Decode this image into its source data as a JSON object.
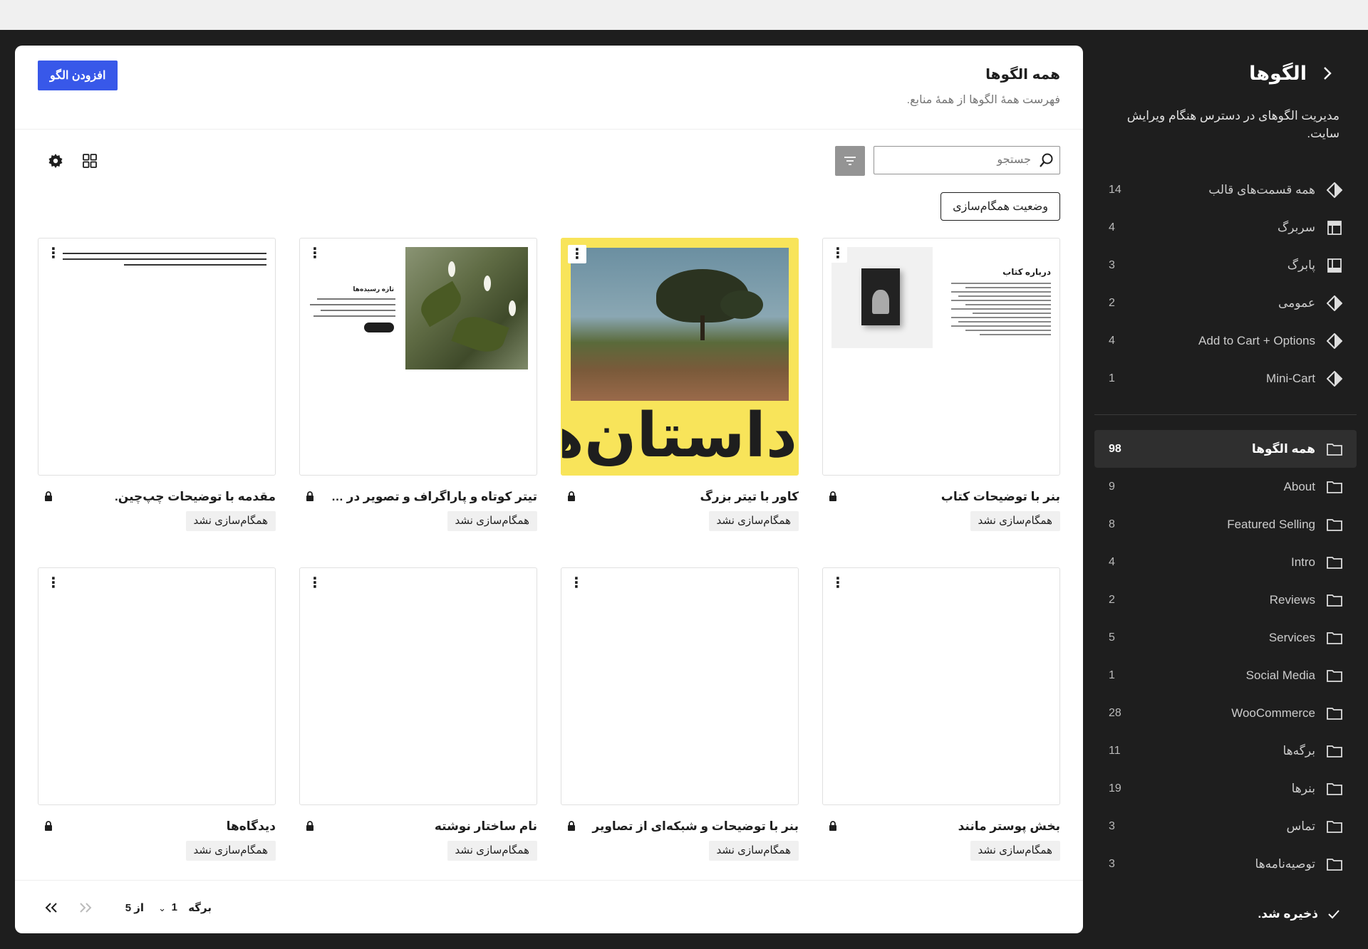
{
  "sidebar": {
    "title": "الگوها",
    "description": "مدیریت الگوهای در دسترس هنگام ویرایش سایت.",
    "template_parts": [
      {
        "label": "همه قسمت‌های قالب",
        "count": "14",
        "icon": "diamond-icon"
      },
      {
        "label": "سربرگ",
        "count": "4",
        "icon": "header-icon"
      },
      {
        "label": "پابرگ",
        "count": "3",
        "icon": "footer-icon"
      },
      {
        "label": "عمومی",
        "count": "2",
        "icon": "diamond-icon"
      },
      {
        "label": "Add to Cart + Options",
        "count": "4",
        "icon": "diamond-icon"
      },
      {
        "label": "Mini-Cart",
        "count": "1",
        "icon": "diamond-icon"
      }
    ],
    "categories": [
      {
        "label": "همه الگوها",
        "count": "98",
        "icon": "folder-icon",
        "active": true
      },
      {
        "label": "About",
        "count": "9",
        "icon": "folder-icon"
      },
      {
        "label": "Featured Selling",
        "count": "8",
        "icon": "folder-icon"
      },
      {
        "label": "Intro",
        "count": "4",
        "icon": "folder-icon"
      },
      {
        "label": "Reviews",
        "count": "2",
        "icon": "folder-icon"
      },
      {
        "label": "Services",
        "count": "5",
        "icon": "folder-icon"
      },
      {
        "label": "Social Media",
        "count": "1",
        "icon": "folder-icon"
      },
      {
        "label": "WooCommerce",
        "count": "28",
        "icon": "folder-icon"
      },
      {
        "label": "برگه‌ها",
        "count": "11",
        "icon": "folder-icon"
      },
      {
        "label": "بنرها",
        "count": "19",
        "icon": "folder-icon"
      },
      {
        "label": "تماس",
        "count": "3",
        "icon": "folder-icon"
      },
      {
        "label": "توصیه‌نامه‌ها",
        "count": "3",
        "icon": "folder-icon"
      }
    ],
    "saved": "ذخیره شد."
  },
  "main": {
    "title": "همه الگوها",
    "subtitle": "فهرست همهٔ الگوها از همهٔ منابع.",
    "add_button": "افزودن الگو",
    "search_placeholder": "جستجو",
    "sync_filter": "وضعیت همگام‌سازی",
    "patterns": [
      {
        "title": "بنر با توضیحات کتاب",
        "badge": "همگام‌سازی نشد",
        "preview": "book"
      },
      {
        "title": "کاور با تیتر بزرگ",
        "badge": "همگام‌سازی نشد",
        "preview": "cover",
        "preview_text": "داستان‌ها"
      },
      {
        "title": "تیتر کوتاه و پاراگراف و تصویر در سم...",
        "badge": "همگام‌سازی نشد",
        "preview": "plant",
        "preview_text": "تازه رسیده‌ها"
      },
      {
        "title": "مقدمه با توضیحات چپ‌چین.",
        "badge": "همگام‌سازی نشد",
        "preview": "intro"
      },
      {
        "title": "بخش پوستر مانند",
        "badge": "همگام‌سازی نشد",
        "preview": "blank"
      },
      {
        "title": "بنر با توضیحات و شبکه‌ای از تصاویر",
        "badge": "همگام‌سازی نشد",
        "preview": "blank"
      },
      {
        "title": "نام ساختار نوشته",
        "badge": "همگام‌سازی نشد",
        "preview": "blank"
      },
      {
        "title": "دیدگاه‌ها",
        "badge": "همگام‌سازی نشد",
        "preview": "blank"
      }
    ],
    "book_preview_title": "درباره کتاب",
    "pagination": {
      "label": "برگه",
      "current": "1",
      "of": "از 5"
    }
  }
}
